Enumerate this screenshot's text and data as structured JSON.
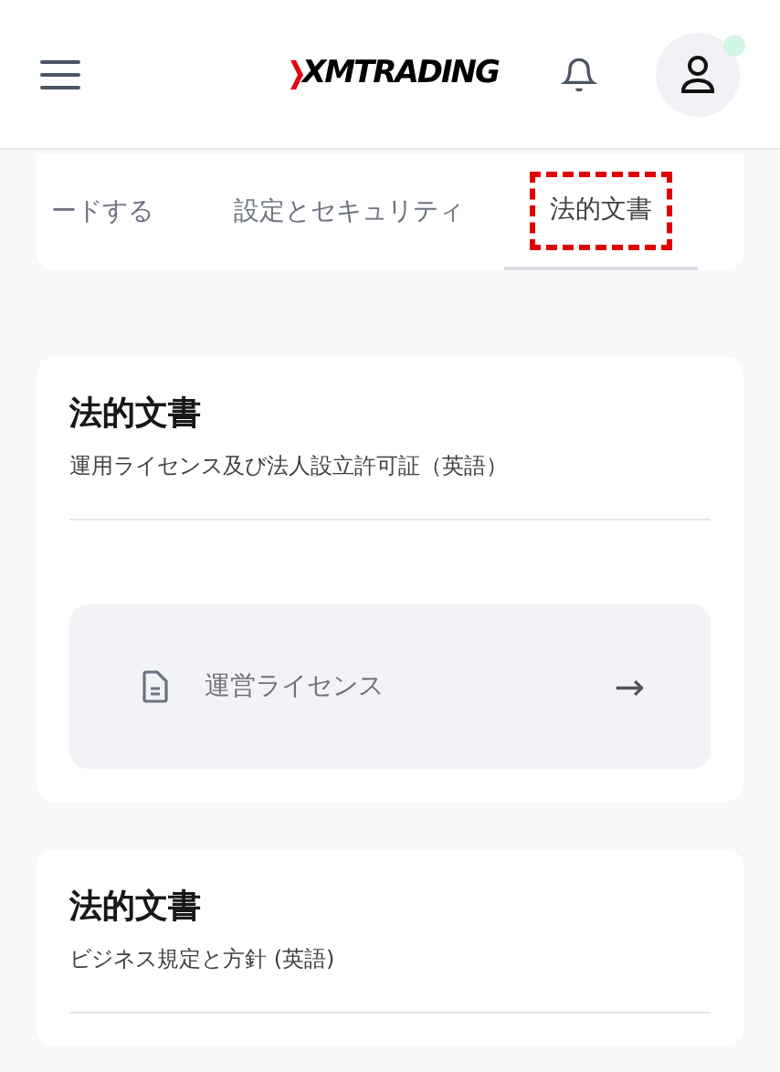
{
  "header": {
    "logo": "XMTRADING",
    "notification_dot": true
  },
  "tabs": [
    {
      "label": "ードする",
      "selected": false,
      "highlighted": false
    },
    {
      "label": "設定とセキュリティ",
      "selected": false,
      "highlighted": false
    },
    {
      "label": "法的文書",
      "selected": true,
      "highlighted": true
    }
  ],
  "sections": [
    {
      "title": "法的文書",
      "subtitle": "運用ライセンス及び法人設立許可証（英語）",
      "items": [
        {
          "label": "運営ライセンス",
          "arrow": "→"
        }
      ]
    },
    {
      "title": "法的文書",
      "subtitle": "ビジネス規定と方針 (英語)"
    }
  ]
}
